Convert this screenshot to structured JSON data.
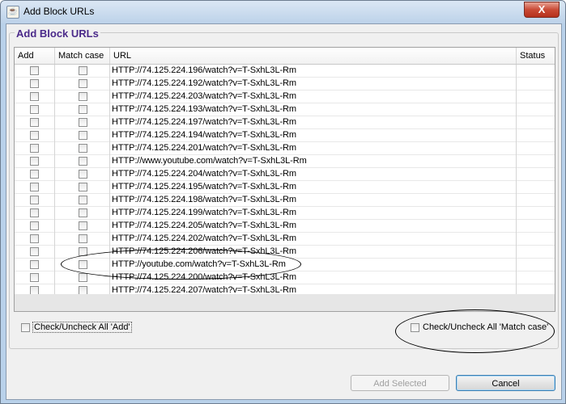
{
  "window": {
    "title": "Add Block URLs",
    "close_glyph": "X",
    "app_icon": "java-icon"
  },
  "group": {
    "title": "Add Block URLs"
  },
  "table": {
    "columns": [
      "Add",
      "Match case",
      "URL",
      "Status"
    ],
    "rows": [
      "HTTP://74.125.224.196/watch?v=T-SxhL3L-Rm",
      "HTTP://74.125.224.192/watch?v=T-SxhL3L-Rm",
      "HTTP://74.125.224.203/watch?v=T-SxhL3L-Rm",
      "HTTP://74.125.224.193/watch?v=T-SxhL3L-Rm",
      "HTTP://74.125.224.197/watch?v=T-SxhL3L-Rm",
      "HTTP://74.125.224.194/watch?v=T-SxhL3L-Rm",
      "HTTP://74.125.224.201/watch?v=T-SxhL3L-Rm",
      "HTTP://www.youtube.com/watch?v=T-SxhL3L-Rm",
      "HTTP://74.125.224.204/watch?v=T-SxhL3L-Rm",
      "HTTP://74.125.224.195/watch?v=T-SxhL3L-Rm",
      "HTTP://74.125.224.198/watch?v=T-SxhL3L-Rm",
      "HTTP://74.125.224.199/watch?v=T-SxhL3L-Rm",
      "HTTP://74.125.224.205/watch?v=T-SxhL3L-Rm",
      "HTTP://74.125.224.202/watch?v=T-SxhL3L-Rm",
      "HTTP://74.125.224.206/watch?v=T-SxhL3L-Rm",
      "HTTP://youtube.com/watch?v=T-SxhL3L-Rm",
      "HTTP://74.125.224.200/watch?v=T-SxhL3L-Rm",
      "HTTP://74.125.224.207/watch?v=T-SxhL3L-Rm"
    ]
  },
  "check_all_add": {
    "label": "Check/Uncheck All 'Add'",
    "checked": false
  },
  "check_all_match": {
    "label": "Check/Uncheck All 'Match case'",
    "checked": false
  },
  "buttons": {
    "add_selected": "Add Selected",
    "cancel": "Cancel"
  },
  "annotations": {
    "circled_row_index": 15,
    "circled_control": "check-all-match-case"
  }
}
